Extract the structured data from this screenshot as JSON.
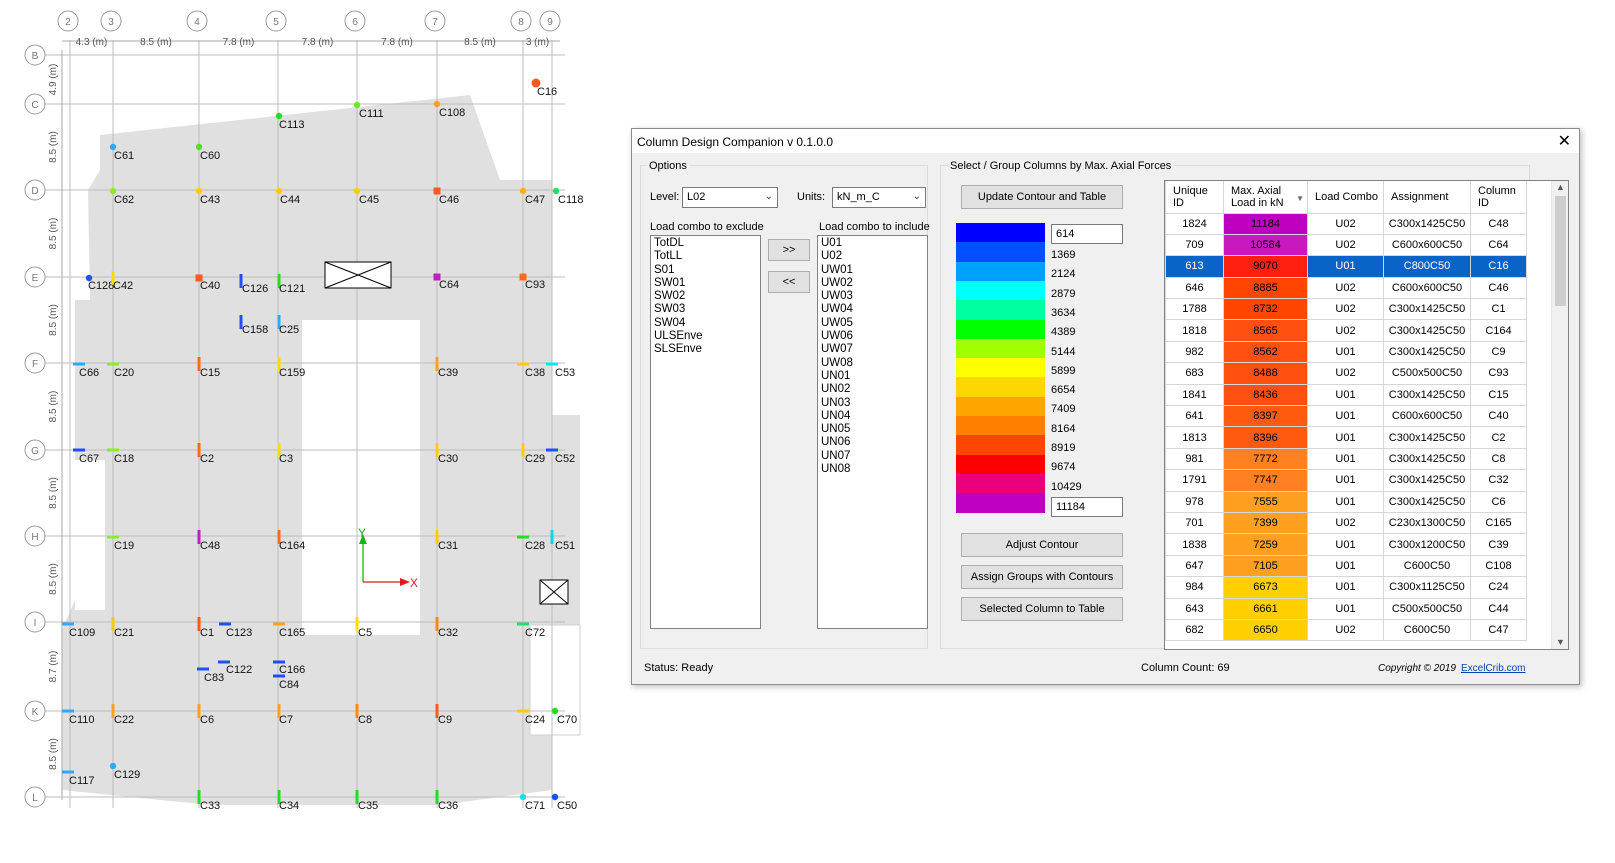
{
  "plan": {
    "grid_x": [
      "2",
      "3",
      "4",
      "5",
      "6",
      "7",
      "8",
      "9"
    ],
    "grid_y": [
      "B",
      "C",
      "D",
      "E",
      "F",
      "G",
      "H",
      "I",
      "K",
      "L"
    ],
    "dims_x": [
      "4.3 (m)",
      "8.5 (m)",
      "7.8 (m)",
      "7.8 (m)",
      "7.8 (m)",
      "8.5 (m)",
      "3 (m)"
    ],
    "dims_y": [
      "4.9 (m)",
      "8.5 (m)",
      "8.5 (m)",
      "8.5 (m)",
      "8.5 (m)",
      "8.5 (m)",
      "8.5 (m)",
      "8.7 (m)",
      "8.5 (m)"
    ],
    "axis_x": "X",
    "axis_y": "Y",
    "columns": [
      {
        "id": "C16",
        "color": "#ff5a1e"
      },
      {
        "id": "C113",
        "color": "#22dd22"
      },
      {
        "id": "C111",
        "color": "#66ee11"
      },
      {
        "id": "C108",
        "color": "#ffa020"
      },
      {
        "id": "C61",
        "color": "#30a8ff"
      },
      {
        "id": "C60",
        "color": "#55dd22"
      },
      {
        "id": "C62",
        "color": "#88ee22"
      },
      {
        "id": "C43",
        "color": "#ffcc00"
      },
      {
        "id": "C44",
        "color": "#ffcc00"
      },
      {
        "id": "C45",
        "color": "#ffcc00"
      },
      {
        "id": "C46",
        "color": "#ff5a1e"
      },
      {
        "id": "C47",
        "color": "#ffb010"
      },
      {
        "id": "C118",
        "color": "#22dd66"
      },
      {
        "id": "C128",
        "color": "#1e50ff"
      },
      {
        "id": "C42",
        "color": "#ffdd00"
      },
      {
        "id": "C40",
        "color": "#ff5a1e"
      },
      {
        "id": "C126",
        "color": "#1e50ff"
      },
      {
        "id": "C121",
        "color": "#22dd22"
      },
      {
        "id": "C64",
        "color": "#c020c0"
      },
      {
        "id": "C93",
        "color": "#ff6a1e"
      },
      {
        "id": "C158",
        "color": "#1e50ff"
      },
      {
        "id": "C25",
        "color": "#30a8ff"
      },
      {
        "id": "C66",
        "color": "#30a8ff"
      },
      {
        "id": "C20",
        "color": "#88ee22"
      },
      {
        "id": "C15",
        "color": "#ff6a1e"
      },
      {
        "id": "C159",
        "color": "#ffdd00"
      },
      {
        "id": "C39",
        "color": "#ffa020"
      },
      {
        "id": "C38",
        "color": "#ffcc00"
      },
      {
        "id": "C53",
        "color": "#00e8e8"
      },
      {
        "id": "C67",
        "color": "#1e50ff"
      },
      {
        "id": "C18",
        "color": "#88ee22"
      },
      {
        "id": "C2",
        "color": "#ff6a1e"
      },
      {
        "id": "C3",
        "color": "#ffdd00"
      },
      {
        "id": "C30",
        "color": "#ffcc00"
      },
      {
        "id": "C29",
        "color": "#ffcc00"
      },
      {
        "id": "C52",
        "color": "#1e50ff"
      },
      {
        "id": "C19",
        "color": "#88ee22"
      },
      {
        "id": "C48",
        "color": "#c020c0"
      },
      {
        "id": "C164",
        "color": "#ff6a1e"
      },
      {
        "id": "C31",
        "color": "#ffcc00"
      },
      {
        "id": "C28",
        "color": "#22dd22"
      },
      {
        "id": "C51",
        "color": "#00d8f0"
      },
      {
        "id": "C109",
        "color": "#30a8ff"
      },
      {
        "id": "C21",
        "color": "#ffcc00"
      },
      {
        "id": "C1",
        "color": "#ff5a1e"
      },
      {
        "id": "C123",
        "color": "#1e50ff"
      },
      {
        "id": "C165",
        "color": "#ffa020"
      },
      {
        "id": "C5",
        "color": "#ffdd00"
      },
      {
        "id": "C32",
        "color": "#ff8a10"
      },
      {
        "id": "C72",
        "color": "#22dd66"
      },
      {
        "id": "C83",
        "color": "#1e50ff"
      },
      {
        "id": "C122",
        "color": "#1e50ff"
      },
      {
        "id": "C166",
        "color": "#1e50ff"
      },
      {
        "id": "C84",
        "color": "#1e50ff"
      },
      {
        "id": "C110",
        "color": "#30a8ff"
      },
      {
        "id": "C22",
        "color": "#ffa020"
      },
      {
        "id": "C6",
        "color": "#ffa020"
      },
      {
        "id": "C7",
        "color": "#ffa020"
      },
      {
        "id": "C8",
        "color": "#ff8a10"
      },
      {
        "id": "C9",
        "color": "#ff5a1e"
      },
      {
        "id": "C24",
        "color": "#ffcc00"
      },
      {
        "id": "C70",
        "color": "#22dd22"
      },
      {
        "id": "C117",
        "color": "#30a8ff"
      },
      {
        "id": "C129",
        "color": "#30a8ff"
      },
      {
        "id": "C33",
        "color": "#22dd22"
      },
      {
        "id": "C34",
        "color": "#22dd22"
      },
      {
        "id": "C35",
        "color": "#22dd22"
      },
      {
        "id": "C36",
        "color": "#22dd22"
      },
      {
        "id": "C71",
        "color": "#00e8e8"
      },
      {
        "id": "C50",
        "color": "#1e50ff"
      }
    ]
  },
  "dialog": {
    "title": "Column Design Companion v 0.1.0.0",
    "options_label": "Options",
    "level_label": "Level:",
    "level_value": "L02",
    "units_label": "Units:",
    "units_value": "kN_m_C",
    "exclude_label": "Load combo to exclude",
    "include_label": "Load combo to include",
    "exclude_items": [
      "TotDL",
      "TotLL",
      "S01",
      "SW01",
      "SW02",
      "SW03",
      "SW04",
      "ULSEnve",
      "SLSEnve"
    ],
    "include_items": [
      "U01",
      "U02",
      "UW01",
      "UW02",
      "UW03",
      "UW04",
      "UW05",
      "UW06",
      "UW07",
      "UW08",
      "UN01",
      "UN02",
      "UN03",
      "UN04",
      "UN05",
      "UN06",
      "UN07",
      "UN08"
    ],
    "move_right": ">>",
    "move_left": "<<",
    "select_group_label": "Select / Group Columns by Max. Axial Forces",
    "update_btn": "Update Contour and Table",
    "legend_min": "614",
    "legend_values": [
      "1369",
      "2124",
      "2879",
      "3634",
      "4389",
      "5144",
      "5899",
      "6654",
      "7409",
      "8164",
      "8919",
      "9674",
      "10429"
    ],
    "legend_max": "11184",
    "legend_colors": [
      "#0000ff",
      "#0050ff",
      "#00a0ff",
      "#00ffff",
      "#00ffa0",
      "#00ff00",
      "#a0ff00",
      "#ffff00",
      "#ffd700",
      "#ffa500",
      "#ff8000",
      "#ff4500",
      "#ff0000",
      "#e8007a",
      "#c000c0"
    ],
    "adjust_btn": "Adjust Contour",
    "assign_btn": "Assign Groups with Contours",
    "selected_btn": "Selected Column to Table",
    "table_headers": [
      "Unique ID",
      "Max. Axial Load in kN",
      "Load Combo",
      "Assignment",
      "Column ID"
    ],
    "rows": [
      {
        "uid": "1824",
        "load": "11184",
        "combo": "U02",
        "assign": "C300x1425C50",
        "col": "C48",
        "color": "#c000c0"
      },
      {
        "uid": "709",
        "load": "10584",
        "combo": "U02",
        "assign": "C600x600C50",
        "col": "C64",
        "color": "#c818c0"
      },
      {
        "uid": "613",
        "load": "9070",
        "combo": "U01",
        "assign": "C800C50",
        "col": "C16",
        "color": "#ff2010",
        "selected": true
      },
      {
        "uid": "646",
        "load": "8885",
        "combo": "U02",
        "assign": "C600x600C50",
        "col": "C46",
        "color": "#ff4500"
      },
      {
        "uid": "1788",
        "load": "8732",
        "combo": "U02",
        "assign": "C300x1425C50",
        "col": "C1",
        "color": "#ff4500"
      },
      {
        "uid": "1818",
        "load": "8565",
        "combo": "U02",
        "assign": "C300x1425C50",
        "col": "C164",
        "color": "#ff5010"
      },
      {
        "uid": "982",
        "load": "8562",
        "combo": "U01",
        "assign": "C300x1425C50",
        "col": "C9",
        "color": "#ff5010"
      },
      {
        "uid": "683",
        "load": "8488",
        "combo": "U02",
        "assign": "C500x500C50",
        "col": "C93",
        "color": "#ff5010"
      },
      {
        "uid": "1841",
        "load": "8436",
        "combo": "U01",
        "assign": "C300x1425C50",
        "col": "C15",
        "color": "#ff5010"
      },
      {
        "uid": "641",
        "load": "8397",
        "combo": "U01",
        "assign": "C600x600C50",
        "col": "C40",
        "color": "#ff5a10"
      },
      {
        "uid": "1813",
        "load": "8396",
        "combo": "U01",
        "assign": "C300x1425C50",
        "col": "C2",
        "color": "#ff5a10"
      },
      {
        "uid": "981",
        "load": "7772",
        "combo": "U01",
        "assign": "C300x1425C50",
        "col": "C8",
        "color": "#ff8020"
      },
      {
        "uid": "1791",
        "load": "7747",
        "combo": "U01",
        "assign": "C300x1425C50",
        "col": "C32",
        "color": "#ff8020"
      },
      {
        "uid": "978",
        "load": "7555",
        "combo": "U01",
        "assign": "C300x1425C50",
        "col": "C6",
        "color": "#ffa020"
      },
      {
        "uid": "701",
        "load": "7399",
        "combo": "U02",
        "assign": "C230x1300C50",
        "col": "C165",
        "color": "#ffa020"
      },
      {
        "uid": "1838",
        "load": "7259",
        "combo": "U01",
        "assign": "C300x1200C50",
        "col": "C39",
        "color": "#ffa020"
      },
      {
        "uid": "647",
        "load": "7105",
        "combo": "U01",
        "assign": "C600C50",
        "col": "C108",
        "color": "#ffa020"
      },
      {
        "uid": "984",
        "load": "6673",
        "combo": "U01",
        "assign": "C300x1125C50",
        "col": "C24",
        "color": "#ffd000"
      },
      {
        "uid": "643",
        "load": "6661",
        "combo": "U01",
        "assign": "C500x500C50",
        "col": "C44",
        "color": "#ffd000"
      },
      {
        "uid": "682",
        "load": "6650",
        "combo": "U02",
        "assign": "C600C50",
        "col": "C47",
        "color": "#ffd000"
      }
    ],
    "status": "Status: Ready",
    "column_count": "Column Count: 69",
    "copyright": "Copyright © 2019",
    "link": "ExcelCrib.com"
  }
}
